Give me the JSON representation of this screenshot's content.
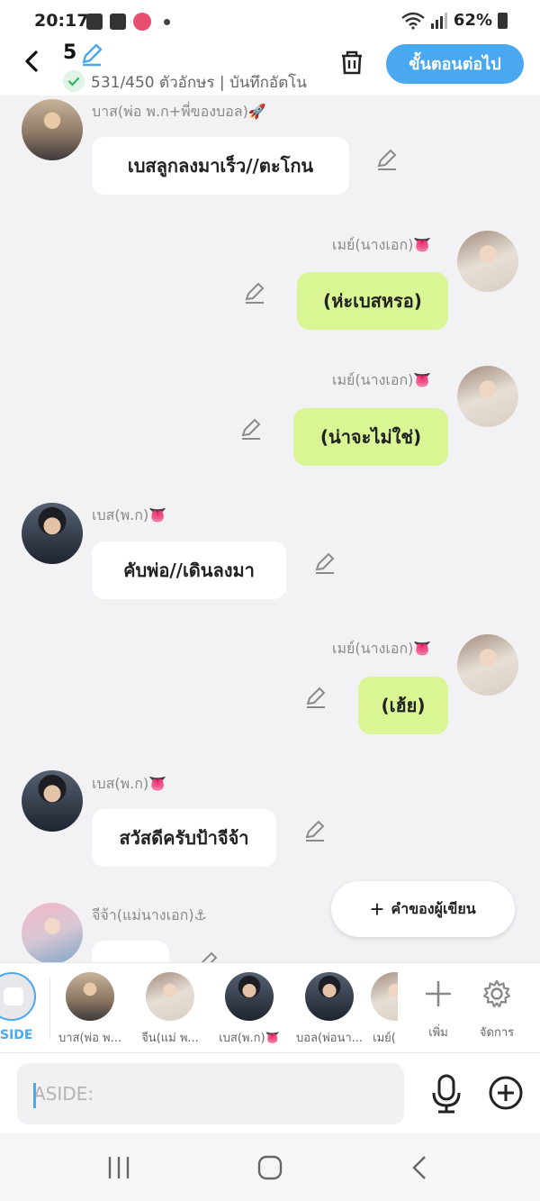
{
  "status_bar": {
    "time": "20:17",
    "battery": "62%"
  },
  "header": {
    "episode_number": "5",
    "char_count": "531/450 ตัวอักษร | บันทึกอัตโน",
    "next_label": "ขั้นตอนต่อไป"
  },
  "messages": [
    {
      "side": "left",
      "name": "บาส(พ่อ พ.ก+พี่ของบอล)🚀",
      "text": "เบสลูกลงมาเร็ว//ตะโกน"
    },
    {
      "side": "right",
      "name": "เมย์(นางเอก)👅",
      "text": "(ห่ะเบสหรอ)"
    },
    {
      "side": "right",
      "name": "เมย์(นางเอก)👅",
      "text": "(น่าจะไม่ใช่)"
    },
    {
      "side": "left",
      "name": "เบส(พ.ก)👅",
      "text": "คับพ่อ//เดินลงมา"
    },
    {
      "side": "right",
      "name": "เมย์(นางเอก)👅",
      "text": "(เฮ้ย)"
    },
    {
      "side": "left",
      "name": "เบส(พ.ก)👅",
      "text": "สวัสดีครับป้าจีจ้า"
    },
    {
      "side": "left",
      "name": "จีจ้า(แม่นางเอก)⚓",
      "text": ""
    }
  ],
  "author_note_label": "คำของผู้เขียน",
  "tray": {
    "aside_label": "SIDE",
    "characters": [
      "บาส(พ่อ พ...",
      "จีน(แม่ พ...",
      "เบส(พ.ก)👅",
      "บอล(พ่อนา...",
      "เมย์("
    ],
    "add_label": "เพิ่ม",
    "manage_label": "จัดการ"
  },
  "input": {
    "placeholder": "ASIDE:"
  },
  "colors": {
    "accent": "#4aa8f0",
    "right_bubble": "#d9f594",
    "left_bubble": "#ffffff"
  }
}
